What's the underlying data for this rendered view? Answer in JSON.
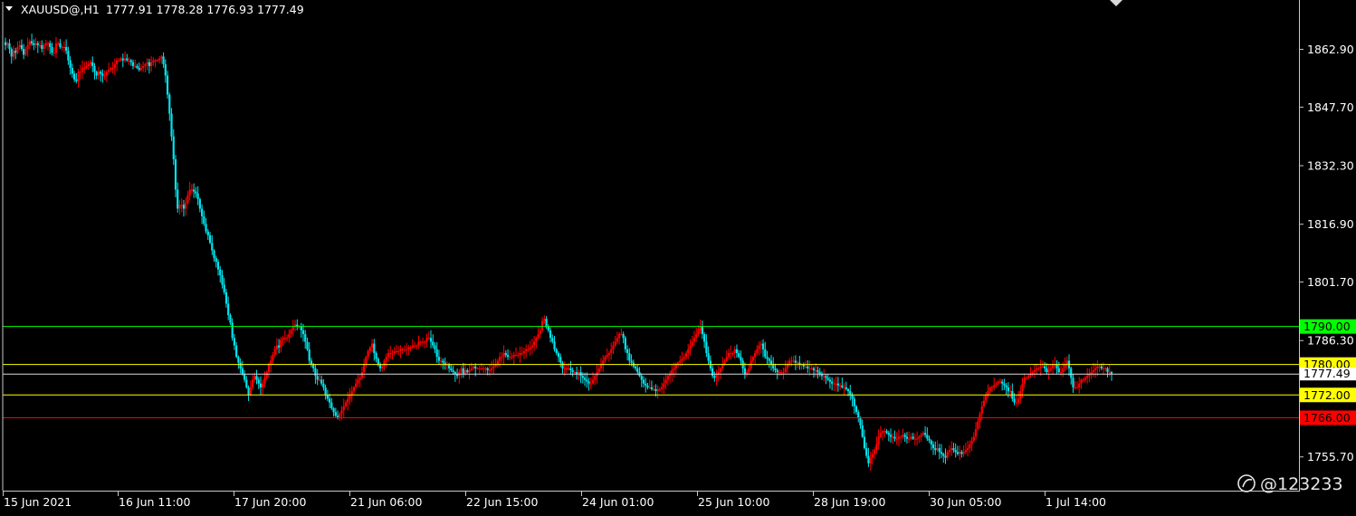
{
  "header": {
    "symbol": "XAUUSD@,H1",
    "ohlc": "1777.91 1778.28 1776.93 1777.49"
  },
  "watermark": "@123233",
  "colors": {
    "background": "#000000",
    "bull": "#ff0000",
    "bear": "#00e5ee",
    "axis": "#c8c8c8"
  },
  "chart_data": {
    "type": "candlestick",
    "title": "XAUUSD@,H1",
    "ylim": [
      1751.5,
      1866.5
    ],
    "y_ticks": [
      "1862.90",
      "1847.70",
      "1832.30",
      "1816.90",
      "1801.70",
      "1786.30",
      "1755.70"
    ],
    "x_ticks": [
      "15 Jun 2021",
      "16 Jun 11:00",
      "17 Jun 20:00",
      "21 Jun 06:00",
      "22 Jun 15:00",
      "24 Jun 01:00",
      "25 Jun 10:00",
      "28 Jun 19:00",
      "30 Jun 05:00",
      "1 Jul 14:00"
    ],
    "levels": [
      {
        "value": 1790.0,
        "label": "1790.00",
        "color": "#00ff00"
      },
      {
        "value": 1780.0,
        "label": "1780.00",
        "color": "#ffff00"
      },
      {
        "value": 1772.0,
        "label": "1772.00",
        "color": "#ffff00"
      },
      {
        "value": 1766.0,
        "label": "1766.00",
        "color": "#ff0000"
      }
    ],
    "current_price": {
      "value": 1777.49,
      "label": "1777.49"
    },
    "closes": [
      1864,
      1864.5,
      1863,
      1861,
      1862.5,
      1862,
      1863.5,
      1864,
      1863,
      1861.5,
      1863,
      1864,
      1865,
      1864.5,
      1864,
      1864.5,
      1864,
      1864,
      1863,
      1864,
      1864.5,
      1864.5,
      1863.5,
      1862,
      1862,
      1864.5,
      1864.5,
      1863.5,
      1863.5,
      1863.5,
      1862.5,
      1860,
      1858,
      1856.5,
      1855,
      1854.5,
      1857,
      1857,
      1858,
      1858,
      1858.5,
      1859,
      1859.5,
      1858.5,
      1857,
      1856,
      1857,
      1856.5,
      1856,
      1856,
      1857,
      1857.5,
      1858,
      1858,
      1859,
      1860,
      1860,
      1860.5,
      1860,
      1860.5,
      1860,
      1860,
      1859.5,
      1858.5,
      1858.5,
      1858,
      1857.5,
      1858,
      1858.5,
      1859,
      1859.5,
      1858.5,
      1859.5,
      1860,
      1860,
      1860,
      1860.5,
      1861,
      1859,
      1856,
      1851,
      1846,
      1840,
      1834,
      1826,
      1821,
      1822,
      1822,
      1821,
      1822.5,
      1824.5,
      1826,
      1826,
      1825.5,
      1825,
      1823.5,
      1821,
      1819,
      1817,
      1815,
      1814,
      1812,
      1810,
      1808,
      1807,
      1805,
      1803.5,
      1801,
      1799,
      1796,
      1793,
      1791,
      1787,
      1785,
      1782,
      1780.5,
      1779,
      1777.5,
      1776,
      1774,
      1772,
      1774,
      1776,
      1777,
      1776,
      1775,
      1774,
      1775,
      1776.5,
      1778,
      1780,
      1781,
      1782.5,
      1784,
      1785,
      1784.5,
      1786.5,
      1787,
      1787,
      1787,
      1788,
      1789,
      1790,
      1790.5,
      1790,
      1790,
      1789,
      1788,
      1786,
      1784,
      1781,
      1780,
      1779,
      1777,
      1776,
      1776,
      1775,
      1774,
      1772,
      1771,
      1770,
      1768.5,
      1767.5,
      1766.5,
      1766,
      1767,
      1768,
      1769,
      1770,
      1771,
      1772,
      1773,
      1774,
      1775,
      1776,
      1776.5,
      1778,
      1780,
      1782,
      1783.5,
      1784.5,
      1785.5,
      1783,
      1781.5,
      1780,
      1779,
      1779.5,
      1781,
      1782,
      1783,
      1783,
      1783,
      1783.5,
      1783.5,
      1783.5,
      1784,
      1784,
      1784,
      1784,
      1784.5,
      1784.5,
      1785,
      1785,
      1785,
      1786,
      1786,
      1786,
      1786,
      1787,
      1787,
      1786,
      1785,
      1784,
      1782,
      1781,
      1781,
      1780.5,
      1780,
      1780,
      1779,
      1778.5,
      1778,
      1777.5,
      1777,
      1778,
      1779,
      1777.5,
      1778.5,
      1778,
      1778.5,
      1779,
      1779.5,
      1779,
      1779,
      1779,
      1779,
      1779,
      1779,
      1778.5,
      1778.5,
      1779,
      1779.5,
      1780,
      1781,
      1782,
      1782,
      1783,
      1782.5,
      1782,
      1782,
      1782,
      1782.5,
      1782.5,
      1782.5,
      1783,
      1783,
      1783.5,
      1784,
      1784,
      1784.5,
      1785,
      1786,
      1787,
      1788,
      1789,
      1791.5,
      1792,
      1790,
      1789,
      1787,
      1786,
      1784,
      1783,
      1782,
      1780.5,
      1779,
      1779,
      1779,
      1779,
      1778.5,
      1778,
      1778,
      1777.5,
      1778,
      1777,
      1776.5,
      1776,
      1775.5,
      1775,
      1775,
      1776,
      1777,
      1778,
      1779,
      1780,
      1781,
      1782,
      1782.5,
      1783,
      1784,
      1785,
      1786,
      1787,
      1788,
      1788,
      1787,
      1784,
      1783,
      1781,
      1780.5,
      1779.5,
      1779,
      1778,
      1777,
      1776,
      1775,
      1774.5,
      1774,
      1774,
      1773.5,
      1773.5,
      1773,
      1773.5,
      1773.5,
      1774,
      1775,
      1776,
      1777,
      1777.5,
      1778.5,
      1779,
      1780,
      1780.5,
      1781,
      1781.5,
      1782,
      1783,
      1784,
      1785,
      1786,
      1787,
      1788,
      1789,
      1790,
      1788,
      1786,
      1783,
      1781,
      1779,
      1777,
      1776.5,
      1777.5,
      1778,
      1779,
      1780,
      1781,
      1782,
      1783,
      1783,
      1783,
      1784,
      1783,
      1782,
      1781,
      1779,
      1777.5,
      1778,
      1779,
      1781,
      1782,
      1783,
      1784,
      1785,
      1785.5,
      1784,
      1782,
      1781.5,
      1781,
      1780,
      1779,
      1778.5,
      1778,
      1778,
      1778,
      1778,
      1779,
      1780,
      1781,
      1781,
      1781,
      1780.5,
      1780.5,
      1780,
      1780,
      1779.5,
      1779.5,
      1779,
      1779,
      1779,
      1778.5,
      1778.5,
      1778,
      1777.5,
      1777,
      1777,
      1776.5,
      1776,
      1775.5,
      1775,
      1775,
      1775,
      1774.5,
      1774.5,
      1774,
      1774,
      1773.5,
      1773,
      1772,
      1771,
      1769,
      1767.5,
      1766,
      1764,
      1761,
      1758,
      1756,
      1754,
      1755.5,
      1756.5,
      1757.5,
      1759,
      1761,
      1762,
      1762.5,
      1762.5,
      1762,
      1761.5,
      1761,
      1761,
      1760.5,
      1760.5,
      1761,
      1761,
      1761.5,
      1761,
      1760.5,
      1760.5,
      1761,
      1760.5,
      1760.5,
      1760.5,
      1761,
      1761.5,
      1762,
      1761.5,
      1760.5,
      1760,
      1759,
      1758,
      1757.5,
      1758,
      1757,
      1756.5,
      1756,
      1755.5,
      1757,
      1757.5,
      1758,
      1757.5,
      1757,
      1756.5,
      1757,
      1756.5,
      1757,
      1757.5,
      1758,
      1759,
      1760,
      1761,
      1763,
      1765,
      1767,
      1769,
      1770.5,
      1772,
      1773,
      1774,
      1774,
      1774.5,
      1775,
      1775.5,
      1775.5,
      1775,
      1774.5,
      1774,
      1773,
      1773,
      1771,
      1770,
      1770,
      1771,
      1773,
      1775,
      1776.5,
      1776.5,
      1777,
      1777.5,
      1778,
      1778.5,
      1779,
      1779,
      1779.5,
      1779.5,
      1779,
      1778,
      1778.5,
      1779,
      1780,
      1780,
      1779,
      1778,
      1778,
      1779,
      1780,
      1781,
      1779,
      1776.5,
      1774,
      1774,
      1774,
      1775,
      1776,
      1776,
      1776.5,
      1777,
      1777.5,
      1778,
      1778.5,
      1779,
      1779.5,
      1779.5,
      1779,
      1779,
      1779,
      1778,
      1778,
      1777.5
    ]
  }
}
